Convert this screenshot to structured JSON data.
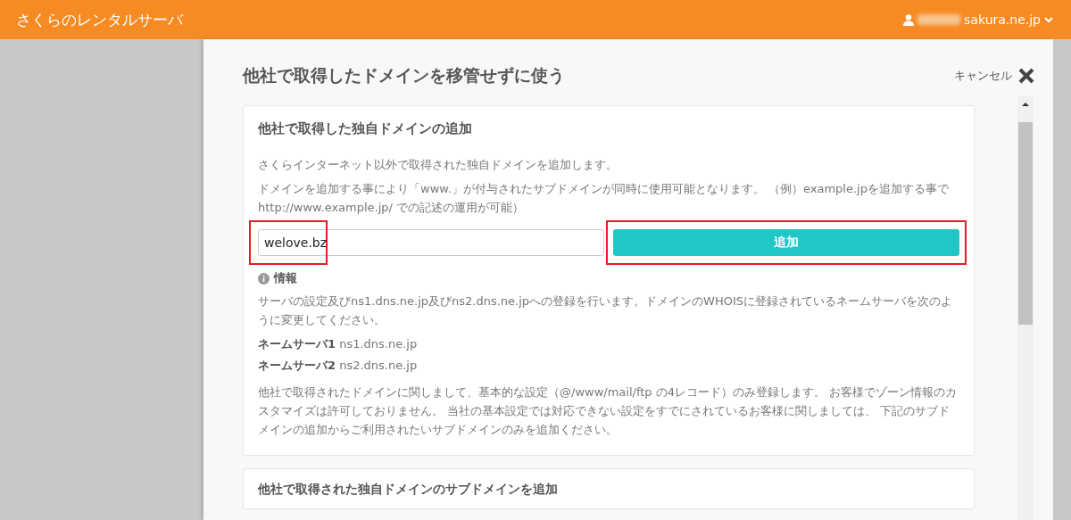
{
  "header": {
    "title": "さくらのレンタルサーバ",
    "account": "sakura.ne.jp"
  },
  "dialog": {
    "title": "他社で取得したドメインを移管せずに使う",
    "cancel": "キャンセル"
  },
  "card": {
    "title": "他社で取得した独自ドメインの追加",
    "paragraphs": [
      "さくらインターネット以外で取得された独自ドメインを追加します。",
      "ドメインを追加する事により「www.」が付与されたサブドメインが同時に使用可能となります。 （例）example.jpを追加する事で http://www.example.jp/ での記述の運用が可能）"
    ],
    "domain_field": {
      "value": "welove.bz",
      "highlighted": true
    },
    "add_button": {
      "label": "追加",
      "highlighted": true
    },
    "info": {
      "heading": "情報",
      "text": "サーバの設定及びns1.dns.ne.jp及びns2.dns.ne.jpへの登録を行います。ドメインのWHOISに登録されているネームサーバを次のように変更してください。",
      "nameservers": [
        {
          "label": "ネームサーバ1",
          "value": "ns1.dns.ne.jp"
        },
        {
          "label": "ネームサーバ2",
          "value": "ns2.dns.ne.jp"
        }
      ],
      "note": "他社で取得されたドメインに関しまして、基本的な設定（@/www/mail/ftp の4レコード）のみ登録します。 お客様でゾーン情報のカスタマイズは許可しておりません。 当社の基本設定では対応できない設定をすでにされているお客様に関しましては、 下記のサブドメインの追加からご利用されたいサブドメインのみを追加ください。"
    }
  },
  "next_card": {
    "title": "他社で取得された独自ドメインのサブドメインを追加"
  }
}
